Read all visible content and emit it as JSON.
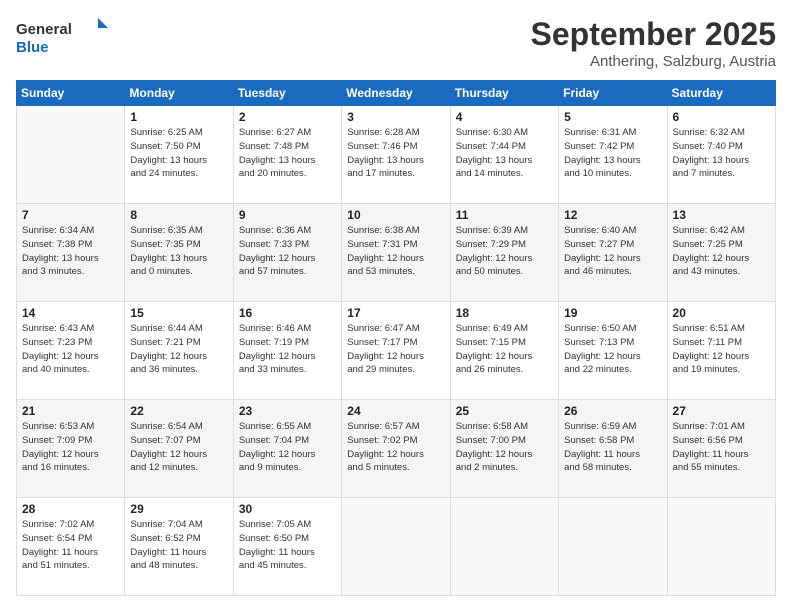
{
  "logo": {
    "line1": "General",
    "line2": "Blue"
  },
  "title": "September 2025",
  "subtitle": "Anthering, Salzburg, Austria",
  "weekdays": [
    "Sunday",
    "Monday",
    "Tuesday",
    "Wednesday",
    "Thursday",
    "Friday",
    "Saturday"
  ],
  "weeks": [
    [
      {
        "day": "",
        "info": ""
      },
      {
        "day": "1",
        "info": "Sunrise: 6:25 AM\nSunset: 7:50 PM\nDaylight: 13 hours\nand 24 minutes."
      },
      {
        "day": "2",
        "info": "Sunrise: 6:27 AM\nSunset: 7:48 PM\nDaylight: 13 hours\nand 20 minutes."
      },
      {
        "day": "3",
        "info": "Sunrise: 6:28 AM\nSunset: 7:46 PM\nDaylight: 13 hours\nand 17 minutes."
      },
      {
        "day": "4",
        "info": "Sunrise: 6:30 AM\nSunset: 7:44 PM\nDaylight: 13 hours\nand 14 minutes."
      },
      {
        "day": "5",
        "info": "Sunrise: 6:31 AM\nSunset: 7:42 PM\nDaylight: 13 hours\nand 10 minutes."
      },
      {
        "day": "6",
        "info": "Sunrise: 6:32 AM\nSunset: 7:40 PM\nDaylight: 13 hours\nand 7 minutes."
      }
    ],
    [
      {
        "day": "7",
        "info": "Sunrise: 6:34 AM\nSunset: 7:38 PM\nDaylight: 13 hours\nand 3 minutes."
      },
      {
        "day": "8",
        "info": "Sunrise: 6:35 AM\nSunset: 7:35 PM\nDaylight: 13 hours\nand 0 minutes."
      },
      {
        "day": "9",
        "info": "Sunrise: 6:36 AM\nSunset: 7:33 PM\nDaylight: 12 hours\nand 57 minutes."
      },
      {
        "day": "10",
        "info": "Sunrise: 6:38 AM\nSunset: 7:31 PM\nDaylight: 12 hours\nand 53 minutes."
      },
      {
        "day": "11",
        "info": "Sunrise: 6:39 AM\nSunset: 7:29 PM\nDaylight: 12 hours\nand 50 minutes."
      },
      {
        "day": "12",
        "info": "Sunrise: 6:40 AM\nSunset: 7:27 PM\nDaylight: 12 hours\nand 46 minutes."
      },
      {
        "day": "13",
        "info": "Sunrise: 6:42 AM\nSunset: 7:25 PM\nDaylight: 12 hours\nand 43 minutes."
      }
    ],
    [
      {
        "day": "14",
        "info": "Sunrise: 6:43 AM\nSunset: 7:23 PM\nDaylight: 12 hours\nand 40 minutes."
      },
      {
        "day": "15",
        "info": "Sunrise: 6:44 AM\nSunset: 7:21 PM\nDaylight: 12 hours\nand 36 minutes."
      },
      {
        "day": "16",
        "info": "Sunrise: 6:46 AM\nSunset: 7:19 PM\nDaylight: 12 hours\nand 33 minutes."
      },
      {
        "day": "17",
        "info": "Sunrise: 6:47 AM\nSunset: 7:17 PM\nDaylight: 12 hours\nand 29 minutes."
      },
      {
        "day": "18",
        "info": "Sunrise: 6:49 AM\nSunset: 7:15 PM\nDaylight: 12 hours\nand 26 minutes."
      },
      {
        "day": "19",
        "info": "Sunrise: 6:50 AM\nSunset: 7:13 PM\nDaylight: 12 hours\nand 22 minutes."
      },
      {
        "day": "20",
        "info": "Sunrise: 6:51 AM\nSunset: 7:11 PM\nDaylight: 12 hours\nand 19 minutes."
      }
    ],
    [
      {
        "day": "21",
        "info": "Sunrise: 6:53 AM\nSunset: 7:09 PM\nDaylight: 12 hours\nand 16 minutes."
      },
      {
        "day": "22",
        "info": "Sunrise: 6:54 AM\nSunset: 7:07 PM\nDaylight: 12 hours\nand 12 minutes."
      },
      {
        "day": "23",
        "info": "Sunrise: 6:55 AM\nSunset: 7:04 PM\nDaylight: 12 hours\nand 9 minutes."
      },
      {
        "day": "24",
        "info": "Sunrise: 6:57 AM\nSunset: 7:02 PM\nDaylight: 12 hours\nand 5 minutes."
      },
      {
        "day": "25",
        "info": "Sunrise: 6:58 AM\nSunset: 7:00 PM\nDaylight: 12 hours\nand 2 minutes."
      },
      {
        "day": "26",
        "info": "Sunrise: 6:59 AM\nSunset: 6:58 PM\nDaylight: 11 hours\nand 58 minutes."
      },
      {
        "day": "27",
        "info": "Sunrise: 7:01 AM\nSunset: 6:56 PM\nDaylight: 11 hours\nand 55 minutes."
      }
    ],
    [
      {
        "day": "28",
        "info": "Sunrise: 7:02 AM\nSunset: 6:54 PM\nDaylight: 11 hours\nand 51 minutes."
      },
      {
        "day": "29",
        "info": "Sunrise: 7:04 AM\nSunset: 6:52 PM\nDaylight: 11 hours\nand 48 minutes."
      },
      {
        "day": "30",
        "info": "Sunrise: 7:05 AM\nSunset: 6:50 PM\nDaylight: 11 hours\nand 45 minutes."
      },
      {
        "day": "",
        "info": ""
      },
      {
        "day": "",
        "info": ""
      },
      {
        "day": "",
        "info": ""
      },
      {
        "day": "",
        "info": ""
      }
    ]
  ]
}
